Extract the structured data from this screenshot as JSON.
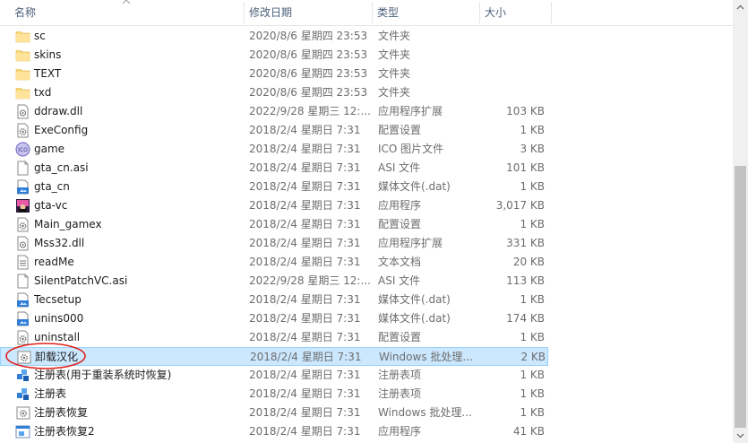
{
  "columns": {
    "name": "名称",
    "modified": "修改日期",
    "type": "类型",
    "size": "大小"
  },
  "colors": {
    "selection_bg": "#cce8ff",
    "selection_border": "#99d1ff",
    "annotation": "#e0211c",
    "folder": "#f8d775"
  },
  "files": [
    {
      "name": "sc",
      "modified": "2020/8/6 星期四 23:53",
      "type": "文件夹",
      "size": "",
      "icon": "folder-icon"
    },
    {
      "name": "skins",
      "modified": "2020/8/6 星期四 23:53",
      "type": "文件夹",
      "size": "",
      "icon": "folder-icon"
    },
    {
      "name": "TEXT",
      "modified": "2020/8/6 星期四 23:53",
      "type": "文件夹",
      "size": "",
      "icon": "folder-icon"
    },
    {
      "name": "txd",
      "modified": "2020/8/6 星期四 23:53",
      "type": "文件夹",
      "size": "",
      "icon": "folder-icon"
    },
    {
      "name": "ddraw.dll",
      "modified": "2022/9/28 星期三 12:...",
      "type": "应用程序扩展",
      "size": "103 KB",
      "icon": "dll-file-icon"
    },
    {
      "name": "ExeConfig",
      "modified": "2018/2/4 星期日 7:31",
      "type": "配置设置",
      "size": "1 KB",
      "icon": "config-file-icon"
    },
    {
      "name": "game",
      "modified": "2018/2/4 星期日 7:31",
      "type": "ICO 图片文件",
      "size": "3 KB",
      "icon": "ico-file-icon"
    },
    {
      "name": "gta_cn.asi",
      "modified": "2018/2/4 星期日 7:31",
      "type": "ASI 文件",
      "size": "101 KB",
      "icon": "blank-file-icon"
    },
    {
      "name": "gta_cn",
      "modified": "2018/2/4 星期日 7:31",
      "type": "媒体文件(.dat)",
      "size": "1 KB",
      "icon": "media-file-icon"
    },
    {
      "name": "gta-vc",
      "modified": "2018/2/4 星期日 7:31",
      "type": "应用程序",
      "size": "3,017 KB",
      "icon": "game-exe-icon"
    },
    {
      "name": "Main_gamex",
      "modified": "2018/2/4 星期日 7:31",
      "type": "配置设置",
      "size": "1 KB",
      "icon": "config-file-icon"
    },
    {
      "name": "Mss32.dll",
      "modified": "2018/2/4 星期日 7:31",
      "type": "应用程序扩展",
      "size": "331 KB",
      "icon": "dll-file-icon"
    },
    {
      "name": "readMe",
      "modified": "2018/2/4 星期日 7:31",
      "type": "文本文档",
      "size": "20 KB",
      "icon": "text-file-icon"
    },
    {
      "name": "SilentPatchVC.asi",
      "modified": "2022/9/28 星期三 12:...",
      "type": "ASI 文件",
      "size": "113 KB",
      "icon": "blank-file-icon"
    },
    {
      "name": "Tecsetup",
      "modified": "2018/2/4 星期日 7:31",
      "type": "媒体文件(.dat)",
      "size": "1 KB",
      "icon": "media-file-icon"
    },
    {
      "name": "unins000",
      "modified": "2018/2/4 星期日 7:31",
      "type": "媒体文件(.dat)",
      "size": "174 KB",
      "icon": "media-file-icon"
    },
    {
      "name": "uninstall",
      "modified": "2018/2/4 星期日 7:31",
      "type": "配置设置",
      "size": "1 KB",
      "icon": "config-file-icon"
    },
    {
      "name": "卸载汉化",
      "modified": "2018/2/4 星期日 7:31",
      "type": "Windows 批处理...",
      "size": "2 KB",
      "icon": "batch-file-icon",
      "selected": true
    },
    {
      "name": "注册表(用于重装系统时恢复)",
      "modified": "2018/2/4 星期日 7:31",
      "type": "注册表项",
      "size": "1 KB",
      "icon": "registry-file-icon"
    },
    {
      "name": "注册表",
      "modified": "2018/2/4 星期日 7:31",
      "type": "注册表项",
      "size": "1 KB",
      "icon": "registry-file-icon"
    },
    {
      "name": "注册表恢复",
      "modified": "2018/2/4 星期日 7:31",
      "type": "Windows 批处理...",
      "size": "1 KB",
      "icon": "batch-file-icon"
    },
    {
      "name": "注册表恢复2",
      "modified": "2018/2/4 星期日 7:31",
      "type": "应用程序",
      "size": "41 KB",
      "icon": "exe-file-icon"
    }
  ]
}
